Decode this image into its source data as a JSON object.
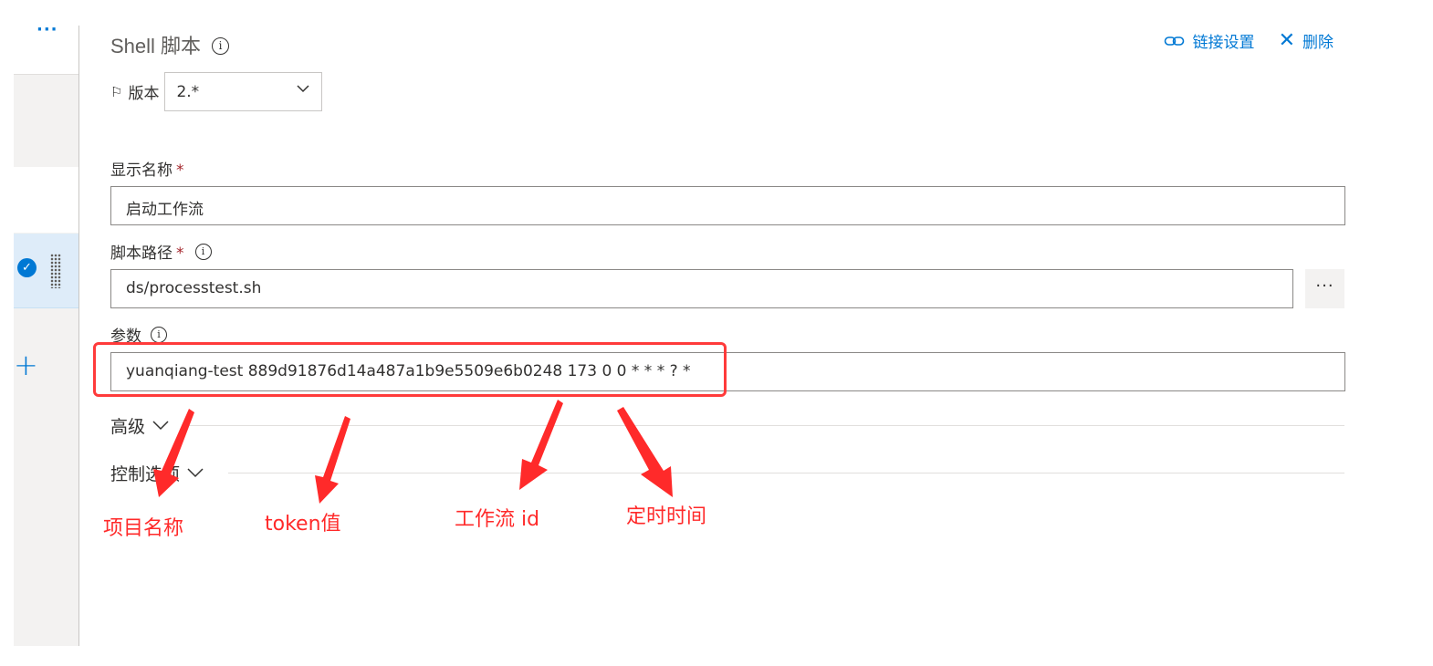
{
  "sidebar": {
    "more_label": "···",
    "add_label": "+",
    "check_label": "✓"
  },
  "header": {
    "title": "Shell 脚本",
    "info_glyph": "i",
    "link_settings_label": "链接设置",
    "delete_label": "删除",
    "delete_glyph": "✕"
  },
  "version": {
    "flag_glyph": "⚐",
    "label": "版本",
    "value": "2.*"
  },
  "form": {
    "display_name": {
      "label": "显示名称",
      "required_mark": "*",
      "value": "启动工作流"
    },
    "script_path": {
      "label": "脚本路径",
      "required_mark": "*",
      "value": "ds/processtest.sh",
      "browse_label": "···"
    },
    "arguments": {
      "label": "参数",
      "value": "yuanqiang-test 889d91876d14a487a1b9e5509e6b0248 173 0 0 * * * ? *"
    }
  },
  "sections": {
    "advanced": "高级",
    "control_options": "控制选项"
  },
  "annotations": {
    "project_name": "项目名称",
    "token": "token值",
    "workflow_id": "工作流 id",
    "schedule": "定时时间"
  },
  "colors": {
    "accent": "#0078d4",
    "annotation_red": "#ff2a2a",
    "required": "#a4262c"
  }
}
